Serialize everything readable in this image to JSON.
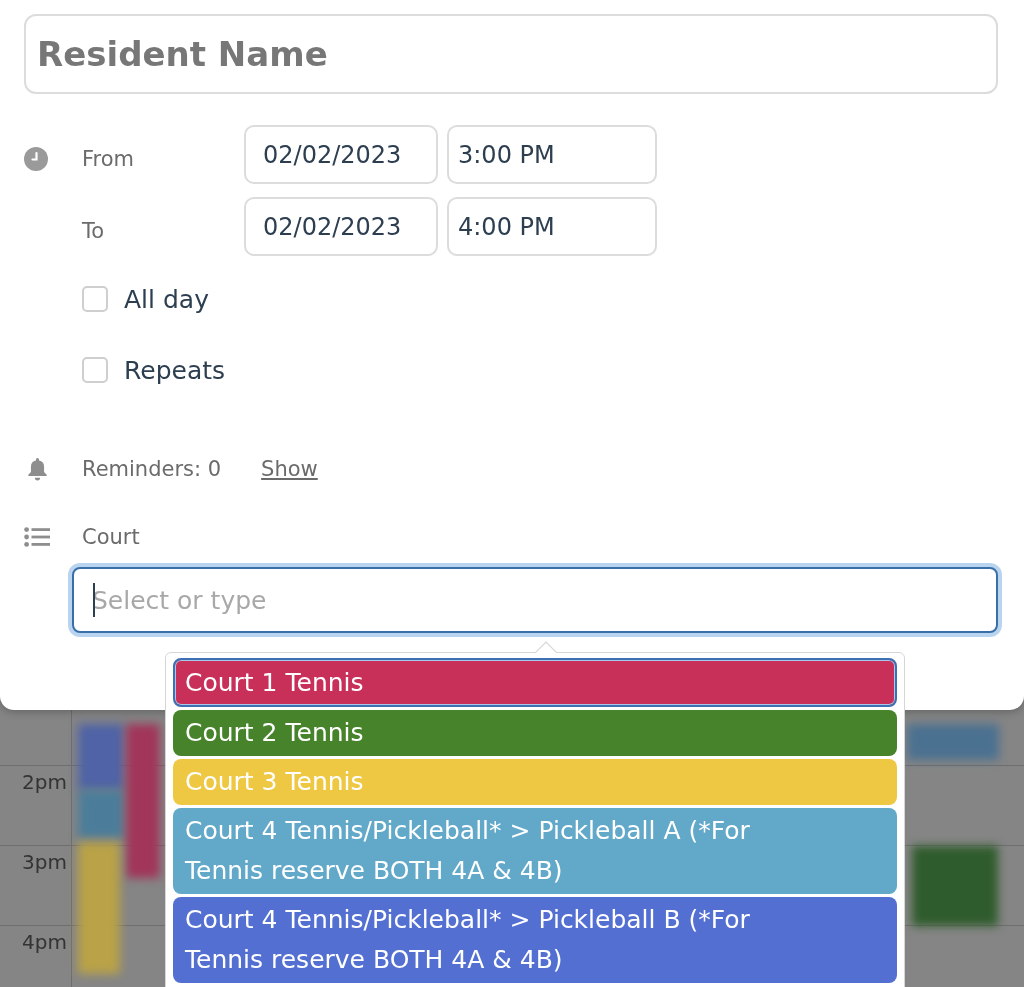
{
  "form": {
    "resident_name": {
      "placeholder": "Resident Name"
    },
    "from": {
      "label": "From",
      "date": "02/02/2023",
      "time": "3:00 PM"
    },
    "to": {
      "label": "To",
      "date": "02/02/2023",
      "time": "4:00 PM"
    },
    "options": [
      {
        "label": "All day",
        "checked": false
      },
      {
        "label": "Repeats",
        "checked": false
      }
    ],
    "reminders": {
      "label": "Reminders: 0",
      "link": "Show"
    },
    "court": {
      "label": "Court",
      "placeholder": "Select or type",
      "focused": true
    }
  },
  "dropdown": {
    "items": [
      {
        "label": "Court 1 Tennis",
        "color": "#c8305a",
        "selected": true
      },
      {
        "label": "Court 2 Tennis",
        "color": "#46832a",
        "selected": false
      },
      {
        "label": "Court 3 Tennis",
        "color": "#efc843",
        "selected": false
      },
      {
        "label": "Court 4 Tennis/Pickleball* > Pickleball A (*For Tennis reserve BOTH 4A & 4B)",
        "color": "#62a8c9",
        "selected": false
      },
      {
        "label": "Court 4 Tennis/Pickleball* > Pickleball B (*For Tennis reserve BOTH 4A & 4B)",
        "color": "#546fd2",
        "selected": false
      }
    ]
  },
  "calendar": {
    "times": [
      "2pm",
      "3pm",
      "4pm"
    ]
  }
}
